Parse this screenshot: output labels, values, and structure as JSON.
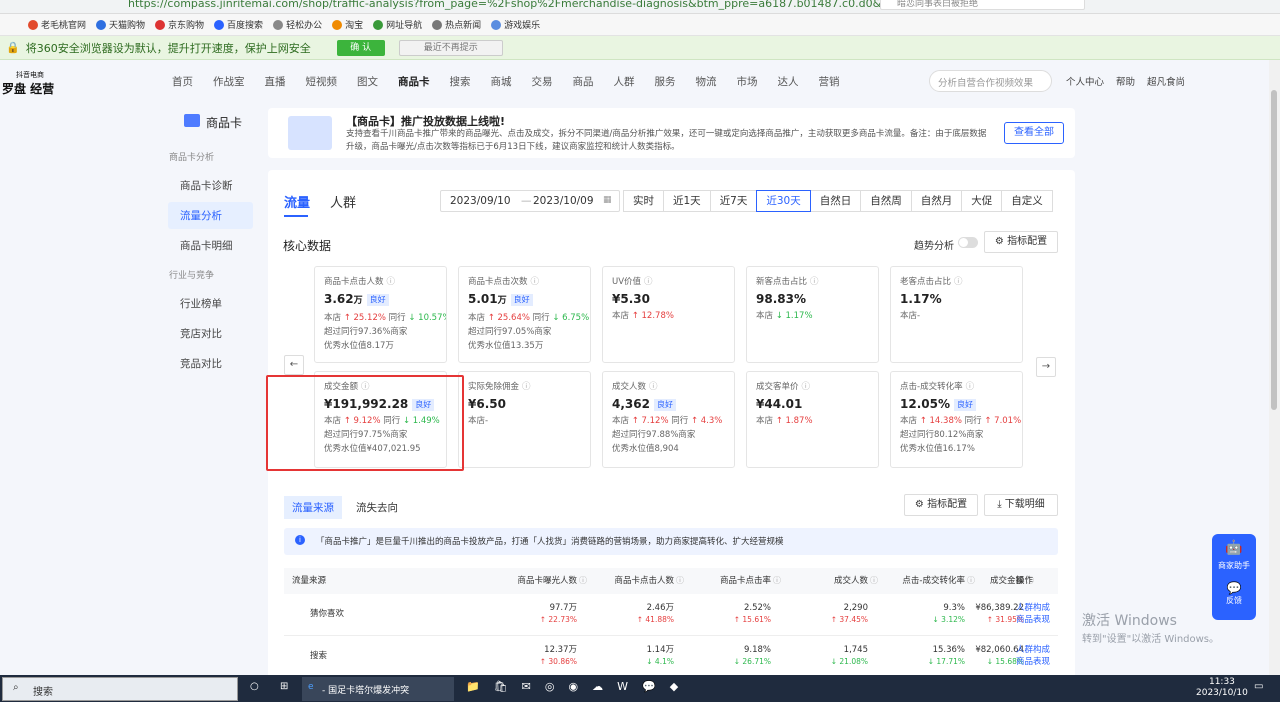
{
  "browser": {
    "url": "https://compass.jinritemai.com/shop/traffic-analysis?from_page=%2Fshop%2Fmerchandise-diagnosis&btm_ppre=a6187.b01487.c0.d0&btm_pre=a6",
    "search_placeholder": "暗恋同事表白被拒绝"
  },
  "bookmarks": [
    "老毛桃官网",
    "天猫购物",
    "京东购物",
    "百度搜索",
    "轻松办公",
    "淘宝",
    "网址导航",
    "热点新闻",
    "游戏娱乐"
  ],
  "safe_bar": {
    "text": "将360安全浏览器设为默认，提升打开速度，保护上网安全",
    "ok": "确 认",
    "no": "最近不再提示"
  },
  "logo": {
    "sub": "抖音电商",
    "name": "罗盘 经营"
  },
  "nav": [
    "首页",
    "作战室",
    "直播",
    "短视频",
    "图文",
    "商品卡",
    "搜索",
    "商城",
    "交易",
    "商品",
    "人群",
    "服务",
    "物流",
    "市场",
    "达人",
    "营销"
  ],
  "nav_active": "商品卡",
  "nav_search": "分析自营合作视频效果",
  "nav_right": {
    "personal": "个人中心",
    "help": "帮助",
    "shop": "超凡食尚"
  },
  "sidebar": {
    "title": "商品卡",
    "group1": "商品卡分析",
    "items1": [
      "商品卡诊断",
      "流量分析",
      "商品卡明细"
    ],
    "group2": "行业与竞争",
    "items2": [
      "行业榜单",
      "竞店对比",
      "竞品对比"
    ]
  },
  "banner": {
    "title": "【商品卡】推广投放数据上线啦!",
    "desc": "支持查看千川商品卡推广带来的商品曝光、点击及成交，拆分不同渠道/商品分析推广效果，还可一键或定向选择商品推广，主动获取更多商品卡流量。备注：由于底层数据升级，商品卡曝光/点击次数等指标已于6月13日下线，建议商家监控和统计人数类指标。",
    "button": "查看全部"
  },
  "tabs": [
    "流量",
    "人群"
  ],
  "date": {
    "start": "2023/09/10",
    "sep": "—",
    "end": "2023/10/09"
  },
  "ranges": [
    "实时",
    "近1天",
    "近7天",
    "近30天",
    "自然日",
    "自然周",
    "自然月",
    "大促",
    "自定义"
  ],
  "range_active": "近30天",
  "core": {
    "title": "核心数据",
    "trend": "趋势分析",
    "config": "指标配置"
  },
  "cards": [
    {
      "label": "商品卡点击人数",
      "value": "3.62",
      "unit": "万",
      "badge": "良好",
      "l1a": "本店 ",
      "l1b": "↑ 25.12%",
      "l1c": " 同行 ",
      "l1d": "↓ 10.57%",
      "l2": "超过同行97.36%商家",
      "l3": "优秀水位值8.17万"
    },
    {
      "label": "商品卡点击次数",
      "value": "5.01",
      "unit": "万",
      "badge": "良好",
      "l1a": "本店 ",
      "l1b": "↑ 25.64%",
      "l1c": " 同行 ",
      "l1d": "↓ 6.75%",
      "l2": "超过同行97.05%商家",
      "l3": "优秀水位值13.35万"
    },
    {
      "label": "UV价值",
      "value": "¥5.30",
      "unit": "",
      "badge": "",
      "l1a": "本店 ",
      "l1b": "↑ 12.78%",
      "l1c": "",
      "l1d": "",
      "l2": "",
      "l3": ""
    },
    {
      "label": "新客点击占比",
      "value": "98.83%",
      "unit": "",
      "badge": "",
      "l1a": "本店 ",
      "l1b": "↓ 1.17%",
      "l1c": "",
      "l1d": "",
      "l2": "",
      "l3": ""
    },
    {
      "label": "老客点击占比",
      "value": "1.17%",
      "unit": "",
      "badge": "",
      "l1a": "本店-",
      "l1b": "",
      "l1c": "",
      "l1d": "",
      "l2": "",
      "l3": ""
    },
    {
      "label": "成交金额",
      "value": "¥191,992.28",
      "unit": "",
      "badge": "良好",
      "l1a": "本店 ",
      "l1b": "↑ 9.12%",
      "l1c": " 同行 ",
      "l1d": "↓ 1.49%",
      "l2": "超过同行97.75%商家",
      "l3": "优秀水位值¥407,021.95"
    },
    {
      "label": "实际免除佣金",
      "value": "¥6.50",
      "unit": "",
      "badge": "",
      "l1a": "本店-",
      "l1b": "",
      "l1c": "",
      "l1d": "",
      "l2": "",
      "l3": ""
    },
    {
      "label": "成交人数",
      "value": "4,362",
      "unit": "",
      "badge": "良好",
      "l1a": "本店 ",
      "l1b": "↑ 7.12%",
      "l1c": " 同行 ",
      "l1d": "↑ 4.3%",
      "l2": "超过同行97.88%商家",
      "l3": "优秀水位值8,904"
    },
    {
      "label": "成交客单价",
      "value": "¥44.01",
      "unit": "",
      "badge": "",
      "l1a": "本店 ",
      "l1b": "↑ 1.87%",
      "l1c": "",
      "l1d": "",
      "l2": "",
      "l3": ""
    },
    {
      "label": "点击-成交转化率",
      "value": "12.05%",
      "unit": "",
      "badge": "良好",
      "l1a": "本店 ",
      "l1b": "↑ 14.38%",
      "l1c": " 同行 ",
      "l1d": "↑ 7.01%",
      "l2": "超过同行80.12%商家",
      "l3": "优秀水位值16.17%"
    }
  ],
  "source_tabs": [
    "流量来源",
    "流失去向"
  ],
  "source_buttons": {
    "config": "指标配置",
    "download": "下载明细"
  },
  "info": "「商品卡推广」是巨量千川推出的商品卡投放产品，打通「人找货」消费链路的营销场景，助力商家提高转化、扩大经营规模",
  "table": {
    "headers": [
      "流量来源",
      "商品卡曝光人数",
      "商品卡点击人数",
      "商品卡点击率",
      "成交人数",
      "点击-成交转化率",
      "成交金额",
      "操作"
    ],
    "rows": [
      {
        "name": "猜你喜欢",
        "v": [
          "97.7万",
          "2.46万",
          "2.52%",
          "2,290",
          "9.3%",
          "¥86,389.22"
        ],
        "c": [
          "↑ 22.73%",
          "↑ 41.88%",
          "↑ 15.61%",
          "↑ 37.45%",
          "↓ 3.12%",
          "↑ 31.95%"
        ],
        "a1": "人群构成",
        "a2": "商品表现"
      },
      {
        "name": "搜索",
        "v": [
          "12.37万",
          "1.14万",
          "9.18%",
          "1,745",
          "15.36%",
          "¥82,060.64"
        ],
        "c": [
          "↑ 30.86%",
          "↓ 4.1%",
          "↓ 26.71%",
          "↓ 21.08%",
          "↓ 17.71%",
          "↓ 15.68%"
        ],
        "a1": "人群构成",
        "a2": "商品表现"
      }
    ]
  },
  "helper": {
    "top": "商家助手",
    "bottom": "反馈"
  },
  "watermark": {
    "l1": "激活 Windows",
    "l2": "转到\"设置\"以激活 Windows。"
  },
  "taskbar": {
    "search": "搜索",
    "task": "- 国足卡塔尔爆发冲突",
    "time": "11:33",
    "date": "2023/10/10"
  },
  "colors": {
    "accent": "#2b62ff",
    "up": "#e53e3e",
    "down": "#2db84d",
    "highlight": "#e53535"
  }
}
